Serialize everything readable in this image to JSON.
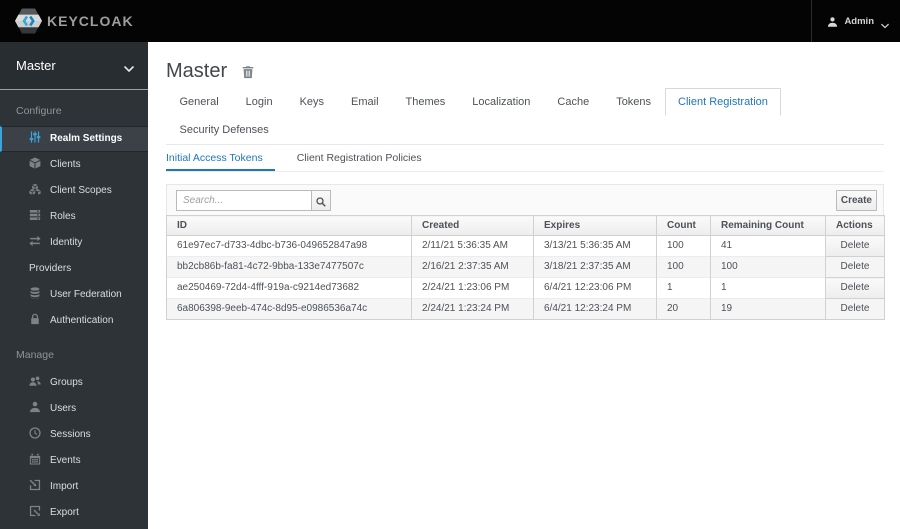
{
  "topbar": {
    "brand": "KEYCLOAK",
    "brand_icon": "keycloak-logo-icon",
    "user": {
      "label": "Admin",
      "icon": "user-icon",
      "caret_icon": "caret-down-icon"
    }
  },
  "sidebar": {
    "realm_selector": {
      "label": "Master",
      "caret_icon": "caret-down-icon"
    },
    "sections": [
      {
        "label": "Configure",
        "items": [
          {
            "label": "Realm Settings",
            "icon": "sliders-icon",
            "active": true
          },
          {
            "label": "Clients",
            "icon": "cube-icon",
            "active": false
          },
          {
            "label": "Client Scopes",
            "icon": "cubes-icon",
            "active": false
          },
          {
            "label": "Roles",
            "icon": "roles-icon",
            "active": false
          },
          {
            "label": "Identity Providers",
            "icon": "exchange-icon",
            "active": false
          },
          {
            "label": "User Federation",
            "icon": "database-icon",
            "active": false
          },
          {
            "label": "Authentication",
            "icon": "lock-icon",
            "active": false
          }
        ]
      },
      {
        "label": "Manage",
        "items": [
          {
            "label": "Groups",
            "icon": "users-icon",
            "active": false
          },
          {
            "label": "Users",
            "icon": "user-icon",
            "active": false
          },
          {
            "label": "Sessions",
            "icon": "clock-icon",
            "active": false
          },
          {
            "label": "Events",
            "icon": "calendar-icon",
            "active": false
          },
          {
            "label": "Import",
            "icon": "import-icon",
            "active": false
          },
          {
            "label": "Export",
            "icon": "export-icon",
            "active": false
          }
        ]
      }
    ]
  },
  "main": {
    "title": "Master",
    "delete_realm_icon": "trash-icon",
    "tabs": [
      {
        "label": "General",
        "active": false
      },
      {
        "label": "Login",
        "active": false
      },
      {
        "label": "Keys",
        "active": false
      },
      {
        "label": "Email",
        "active": false
      },
      {
        "label": "Themes",
        "active": false
      },
      {
        "label": "Localization",
        "active": false
      },
      {
        "label": "Cache",
        "active": false
      },
      {
        "label": "Tokens",
        "active": false
      },
      {
        "label": "Client Registration",
        "active": true
      },
      {
        "label": "Security Defenses",
        "active": false
      }
    ],
    "subtabs": [
      {
        "label": "Initial Access Tokens",
        "active": true
      },
      {
        "label": "Client Registration Policies",
        "active": false
      }
    ],
    "toolbar": {
      "search_placeholder": "Search...",
      "search_icon": "search-icon",
      "create_label": "Create"
    },
    "table": {
      "columns": [
        "ID",
        "Created",
        "Expires",
        "Count",
        "Remaining Count",
        "Actions"
      ],
      "rows": [
        {
          "id": "61e97ec7-d733-4dbc-b736-049652847a98",
          "created": "2/11/21 5:36:35 AM",
          "expires": "3/13/21 5:36:35 AM",
          "count": "100",
          "remaining_count": "41",
          "action": "Delete"
        },
        {
          "id": "bb2cb86b-fa81-4c72-9bba-133e7477507c",
          "created": "2/16/21 2:37:35 AM",
          "expires": "3/18/21 2:37:35 AM",
          "count": "100",
          "remaining_count": "100",
          "action": "Delete"
        },
        {
          "id": "ae250469-72d4-4fff-919a-c9214ed73682",
          "created": "2/24/21 1:23:06 PM",
          "expires": "6/4/21 12:23:06 PM",
          "count": "1",
          "remaining_count": "1",
          "action": "Delete"
        },
        {
          "id": "6a806398-9eeb-474c-8d95-e0986536a74c",
          "created": "2/24/21 1:23:24 PM",
          "expires": "6/4/21 12:23:24 PM",
          "count": "20",
          "remaining_count": "19",
          "action": "Delete"
        }
      ]
    }
  },
  "colors": {
    "topbar_bg": "#040404",
    "sidebar_bg": "#2e3338",
    "sidebar_active_blue": "#39a5dc",
    "accent_blue": "#2076bd"
  }
}
